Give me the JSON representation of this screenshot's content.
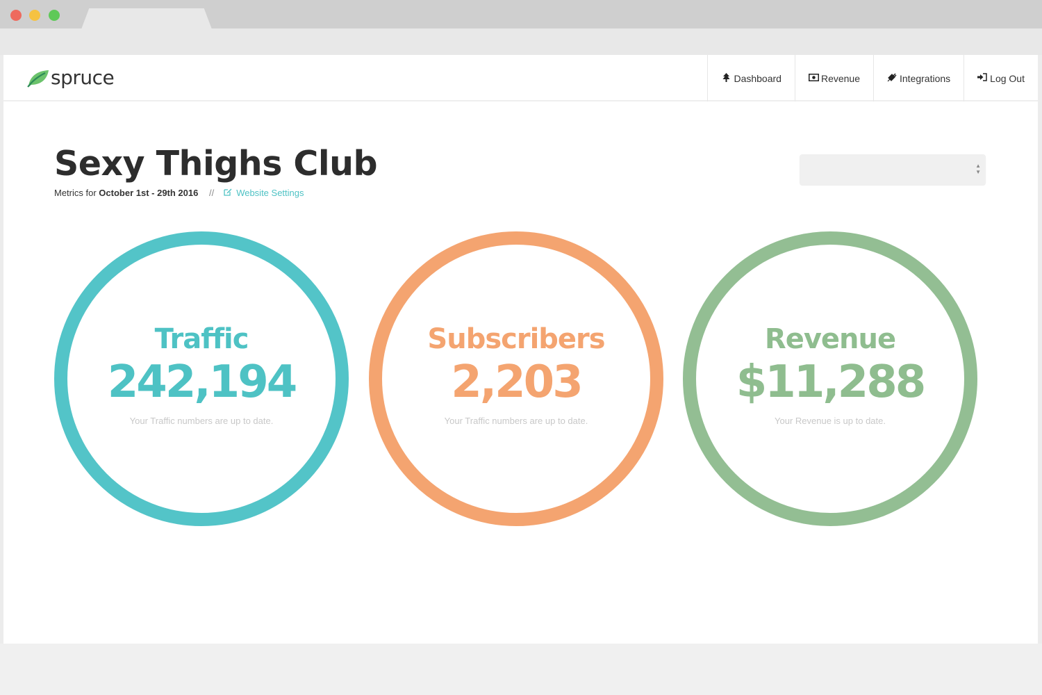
{
  "brand": {
    "name": "spruce",
    "icon": "leaf-icon"
  },
  "nav": {
    "items": [
      {
        "label": "Dashboard",
        "icon": "tree-icon"
      },
      {
        "label": "Revenue",
        "icon": "money-icon"
      },
      {
        "label": "Integrations",
        "icon": "plug-icon"
      },
      {
        "label": "Log Out",
        "icon": "sign-in-icon"
      }
    ]
  },
  "page": {
    "title": "Sexy Thighs Club",
    "metrics_prefix": "Metrics for",
    "date_range": "October 1st - 29th 2016",
    "separator": "//",
    "settings_link": "Website Settings",
    "settings_icon": "edit-icon"
  },
  "site_select": {
    "value": ""
  },
  "metrics": [
    {
      "label": "Traffic",
      "value": "242,194",
      "note": "Your Traffic numbers are up to date.",
      "color": "#53c4c8"
    },
    {
      "label": "Subscribers",
      "value": "2,203",
      "note": "Your Traffic numbers are up to date.",
      "color": "#f4a470"
    },
    {
      "label": "Revenue",
      "value": "$11,288",
      "note": "Your Revenue is up to date.",
      "color": "#93be93"
    }
  ]
}
